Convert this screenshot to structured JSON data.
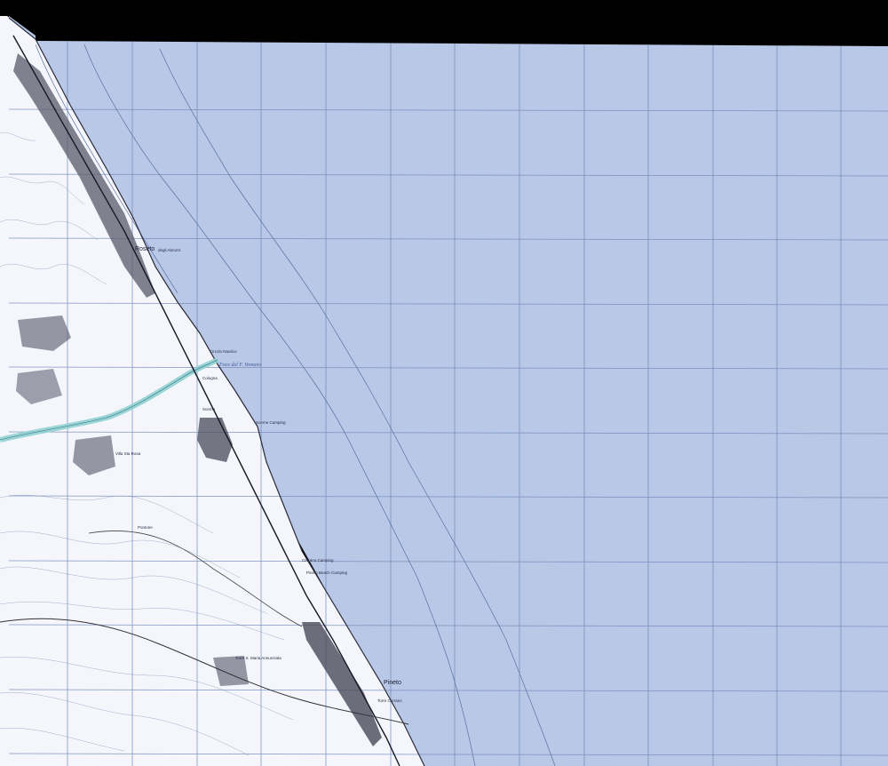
{
  "map": {
    "type": "topographic-map-sheet",
    "colors": {
      "sea": "#b8c8e6",
      "land": "#ffffff",
      "grid": "#6f86b8",
      "urban": "#3a3a4a",
      "river": "#8fd1d0",
      "background": "#000000"
    },
    "places": {
      "roseto": "Roseto",
      "roseto_suffix": "degli Abruzzi",
      "pineto": "Pineto",
      "foce_vomano": "Foce del F. Vomano",
      "circolo_nautico": "Circolo Nautico",
      "cologna": "Cologna",
      "scerne_camping": "Scerne Camping",
      "villa_sia_rosa": "Villa Sta Rosa",
      "pineto_camping": "Pineto Beach Camping",
      "ravenna_camping": "Cerrano Camping",
      "torre_cerrano": "Torre Cerrano",
      "torre_s_maria": "Torre S. Maria Annunziata",
      "scerne": "Scerne",
      "pontone": "Pontone"
    }
  }
}
